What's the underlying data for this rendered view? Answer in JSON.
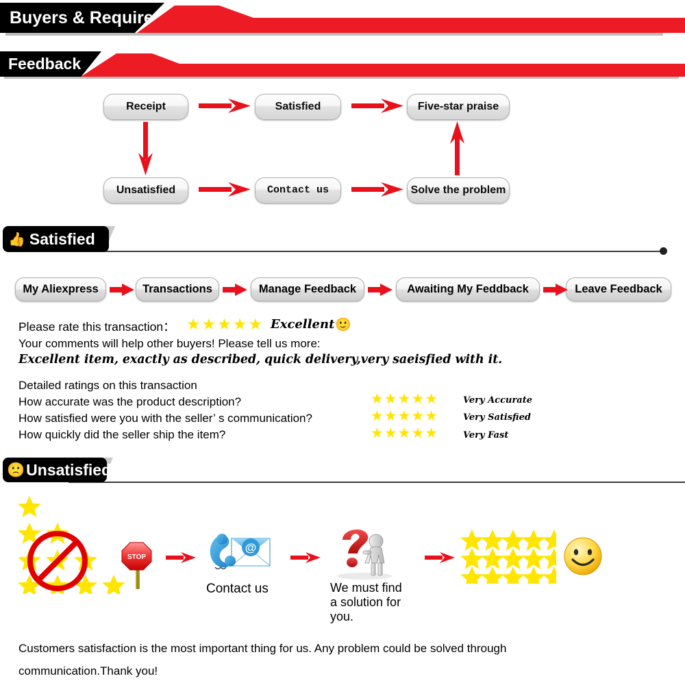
{
  "banners": [
    {
      "title": "Buyers & Required"
    },
    {
      "title": "Feedback"
    }
  ],
  "sections": {
    "satisfied": {
      "label": "Satisfied",
      "icon": "thumbs-up-icon"
    },
    "unsatisfied": {
      "label": "Unsatisfied",
      "icon": "sad-face-icon"
    }
  },
  "flowchart": {
    "nodes": [
      {
        "label": "Receipt"
      },
      {
        "label": "Satisfied"
      },
      {
        "label": "Five-star praise"
      },
      {
        "label": "Unsatisfied"
      },
      {
        "label": "Contact us"
      },
      {
        "label": "Solve the problem"
      }
    ]
  },
  "breadcrumbs": [
    {
      "label": "My Aliexpress"
    },
    {
      "label": "Transactions"
    },
    {
      "label": "Manage Feedback"
    },
    {
      "label": "Awaiting My Feddback"
    },
    {
      "label": "Leave Feedback"
    }
  ],
  "rating": {
    "prompt": "Please rate this transaction：",
    "stars": "★★★★★",
    "star_count": 5,
    "verdict": "Excellent",
    "verdict_emoji": "🙂",
    "comments_prompt": "Your comments will help other buyers! Please tell us more:",
    "comment_text": "Excellent item, exactly as described, quick delivery,very saeisfied with it."
  },
  "detailed_ratings": {
    "heading": "Detailed ratings on this transaction",
    "rows": [
      {
        "question": "How accurate was the product description?",
        "stars": "★★★★★",
        "value": "Very Accurate"
      },
      {
        "question": "How satisfied were you with the seller’ s communication?",
        "stars": "★★★★★",
        "value": "Very Satisfied"
      },
      {
        "question": "How quickly did the seller ship the item?",
        "stars": "★★★★★",
        "value": "Very Fast"
      }
    ]
  },
  "unsatisfied_flow": {
    "stop_label": "STOP",
    "contact_label": "Contact us",
    "solution_label": "We must find\na solution for\nyou.",
    "solution_line1": "We must find",
    "solution_line2": "a solution for",
    "solution_line3": "you.",
    "bad_stars_rows": [
      1,
      2,
      3,
      4
    ],
    "good_stars_rows": [
      5,
      5,
      5
    ],
    "final_emoji": "🙂"
  },
  "footer": {
    "line1": "Customers satisfaction is the most important thing for us. Any problem could be solved through",
    "line2": "communication.Thank you!"
  },
  "colors": {
    "red": "#ED1C24",
    "star_yellow": "#FFE500",
    "black": "#000000",
    "arrow_red": "#E8111B"
  }
}
